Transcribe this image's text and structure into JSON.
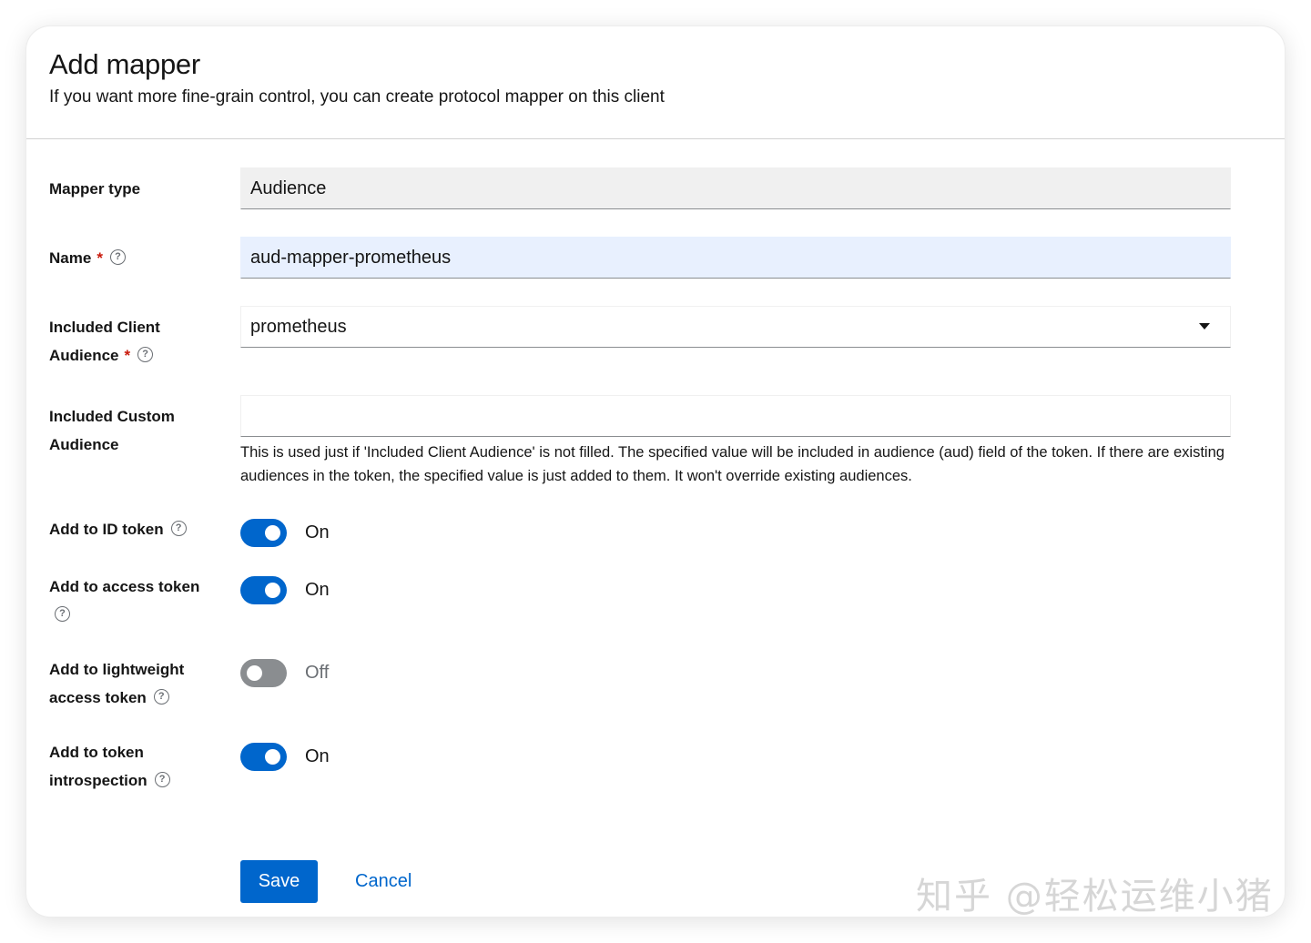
{
  "dialog": {
    "title": "Add mapper",
    "subtitle": "If you want more fine-grain control, you can create protocol mapper on this client"
  },
  "form": {
    "mapper_type": {
      "label": "Mapper type",
      "value": "Audience"
    },
    "name": {
      "label": "Name",
      "required": "*",
      "value": "aud-mapper-prometheus"
    },
    "included_client_audience": {
      "label_line1": "Included Client",
      "label_line2": "Audience",
      "required": "*",
      "value": "prometheus"
    },
    "included_custom_audience": {
      "label_line1": "Included Custom",
      "label_line2": "Audience",
      "value": "",
      "helper": "This is used just if 'Included Client Audience' is not filled. The specified value will be included in audience (aud) field of the token. If there are existing audiences in the token, the specified value is just added to them. It won't override existing audiences."
    },
    "add_to_id_token": {
      "label": "Add to ID token",
      "state": "On"
    },
    "add_to_access_token": {
      "label": "Add to access token",
      "state": "On"
    },
    "add_to_lightweight_access_token": {
      "label_line1": "Add to lightweight",
      "label_line2": "access token",
      "state": "Off"
    },
    "add_to_token_introspection": {
      "label_line1": "Add to token",
      "label_line2": "introspection",
      "state": "On"
    }
  },
  "actions": {
    "save": "Save",
    "cancel": "Cancel"
  },
  "help_glyph": "?",
  "watermark": "知乎 @轻松运维小猪",
  "colors": {
    "primary": "#0066cc",
    "required": "#c9190b",
    "toggle_off": "#8a8d90",
    "autofill": "#e8f0fe"
  }
}
